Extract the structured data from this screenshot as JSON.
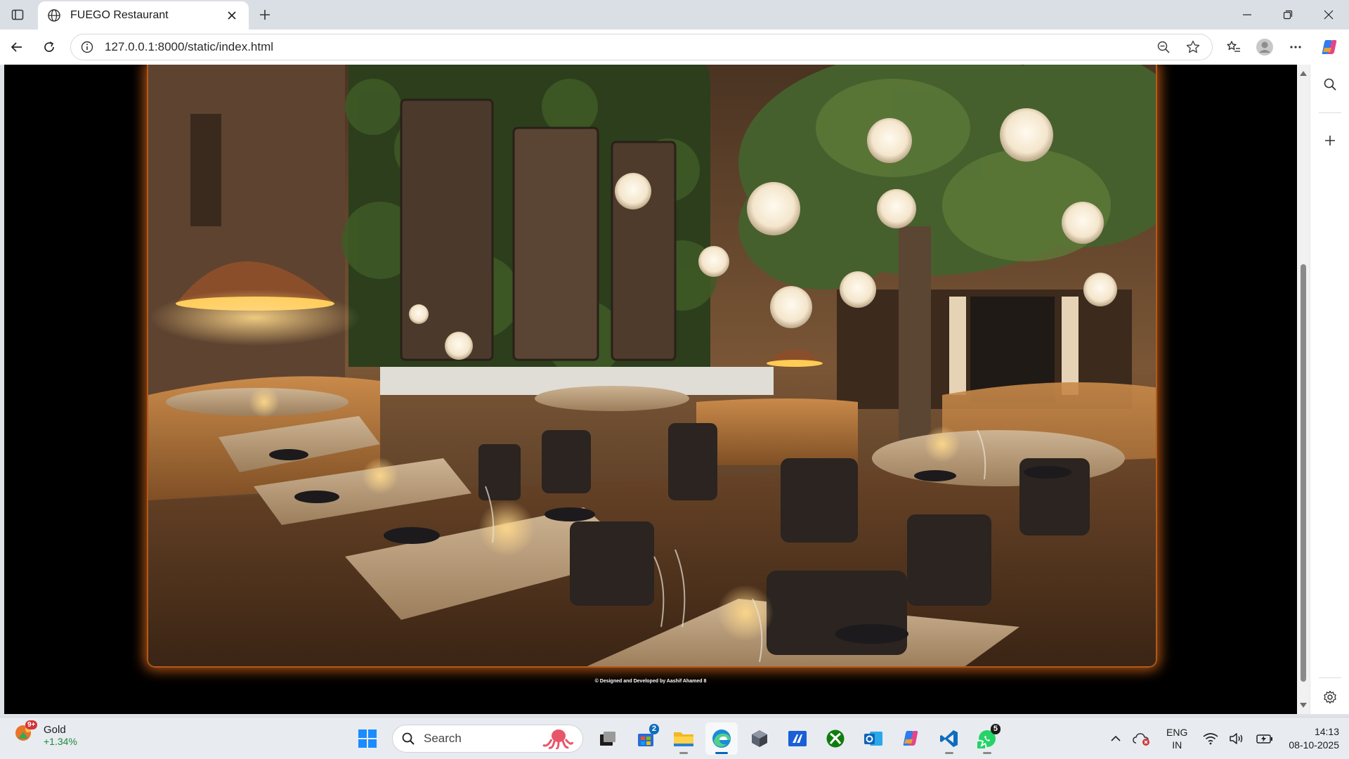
{
  "browser": {
    "tab": {
      "title": "FUEGO Restaurant"
    },
    "address": {
      "url": "127.0.0.1:8000/static/index.html"
    }
  },
  "page": {
    "footer_text": "© Designed and Developed by Aashif Ahamed 8"
  },
  "taskbar": {
    "weather": {
      "badge": "9+",
      "name": "Gold",
      "change": "+1.34%"
    },
    "search": {
      "label": "Search"
    },
    "badges": {
      "store": "2",
      "whatsapp": "5"
    },
    "language": {
      "line1": "ENG",
      "line2": "IN"
    },
    "clock": {
      "time": "14:13",
      "date": "08-10-2025"
    }
  },
  "colors": {
    "accent": "#0067c0",
    "glow": "#e66e1e",
    "gain": "#1e8a3c"
  }
}
